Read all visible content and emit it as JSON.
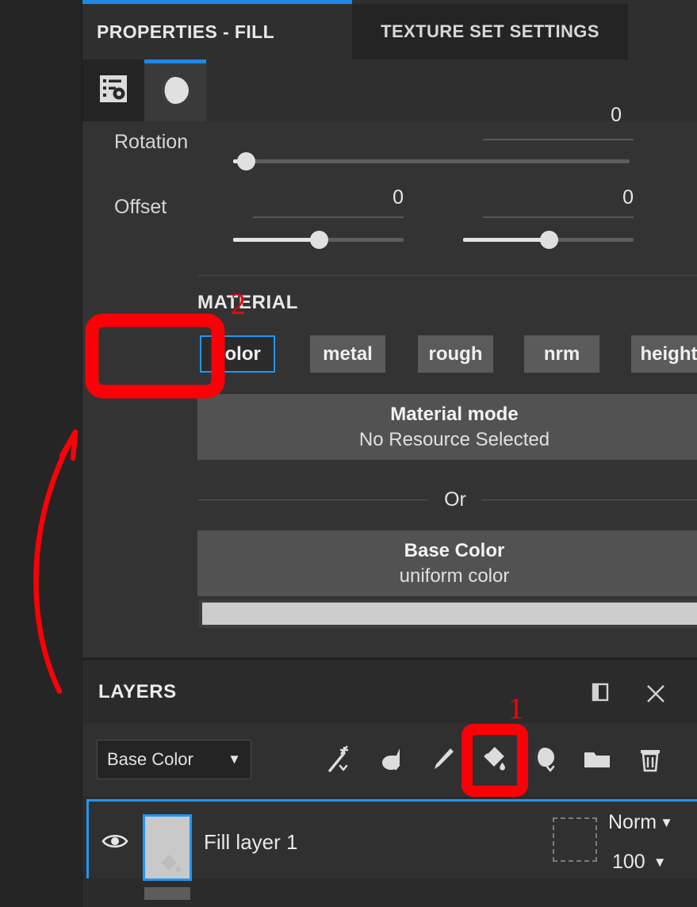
{
  "app": {
    "accent_blue": "#1e88e5",
    "annotation_red": "#fb0007",
    "panel_bg": "#2f2f2f",
    "body_bg": "#333333"
  },
  "properties_panel": {
    "tab_title": "PROPERTIES - FILL",
    "close_icon": "close-icon",
    "secondary_tab": "TEXTURE SET SETTINGS",
    "subtabs": [
      {
        "icon": "parameters-gear-icon",
        "selected": false
      },
      {
        "icon": "material-sphere-icon",
        "selected": true
      }
    ],
    "rows": [
      {
        "label": "Rotation",
        "value_a": "0",
        "value_b": ""
      },
      {
        "label": "Offset",
        "value_a": "0",
        "value_b": "0"
      }
    ],
    "material": {
      "section_title": "MATERIAL",
      "channels": [
        {
          "label": "color",
          "selected": true
        },
        {
          "label": "metal",
          "selected": false
        },
        {
          "label": "rough",
          "selected": false
        },
        {
          "label": "nrm",
          "selected": false
        },
        {
          "label": "height",
          "selected": false
        }
      ],
      "material_mode": {
        "title": "Material mode",
        "subtitle": "No Resource Selected"
      },
      "or_text": "Or",
      "base_color": {
        "title": "Base Color",
        "subtitle": "uniform color",
        "swatch_hex": "#cdcdcd"
      }
    }
  },
  "layers_panel": {
    "title": "LAYERS",
    "header_icons": [
      {
        "name": "dock-panel-icon"
      },
      {
        "name": "close-icon"
      }
    ],
    "channel_selector": {
      "value": "Base Color",
      "caret": "chevron-down-icon"
    },
    "toolbar_icons": [
      {
        "name": "magic-wand-icon",
        "tooltip": "Add smart mask"
      },
      {
        "name": "smart-material-icon",
        "tooltip": "Add smart material"
      },
      {
        "name": "paint-brush-icon",
        "tooltip": "Add paint layer"
      },
      {
        "name": "paint-bucket-icon",
        "tooltip": "Add fill layer"
      },
      {
        "name": "effects-icon",
        "tooltip": "Add effect"
      },
      {
        "name": "folder-icon",
        "tooltip": "Add group"
      },
      {
        "name": "trash-icon",
        "tooltip": "Delete layer"
      }
    ],
    "layers": [
      {
        "visible": true,
        "eye_icon": "eye-icon",
        "thumbnail_icon": "paint-bucket-icon",
        "name": "Fill layer 1",
        "mask": "empty-mask-slot",
        "blend_mode": "Norm",
        "opacity": "100"
      }
    ]
  },
  "annotations": [
    {
      "label": "1",
      "target": "paint-bucket-icon",
      "shape": "rect"
    },
    {
      "label": "2",
      "target": "color-channel-button",
      "shape": "rect"
    },
    {
      "label": "",
      "target": "properties-panel",
      "shape": "curved-arrow"
    }
  ]
}
